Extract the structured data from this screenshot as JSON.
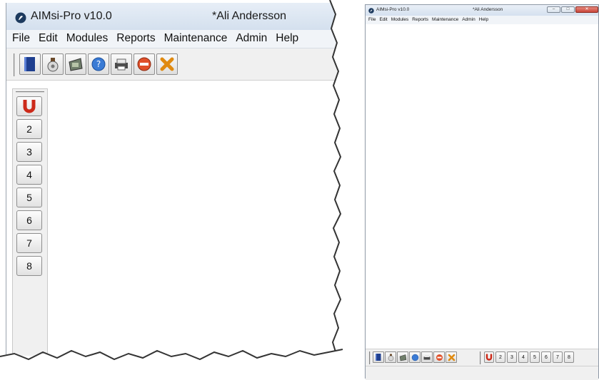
{
  "window": {
    "app_title": "AIMsi-Pro v10.0",
    "user_title": "*Ali Andersson"
  },
  "menu": [
    "File",
    "Edit",
    "Modules",
    "Reports",
    "Maintenance",
    "Admin",
    "Help"
  ],
  "toolbar_icons": [
    "module-icon",
    "money-bag-icon",
    "cash-register-icon",
    "help-icon",
    "printer-icon",
    "stop-icon",
    "exit-icon"
  ],
  "module_buttons": [
    "2",
    "3",
    "4",
    "5",
    "6",
    "7",
    "8"
  ],
  "window_controls": [
    "minimize",
    "maximize",
    "close"
  ],
  "colors": {
    "title_bar": "#d4e0ee",
    "close_button": "#c9453a",
    "first_button_icon": "#cc2a1a"
  }
}
